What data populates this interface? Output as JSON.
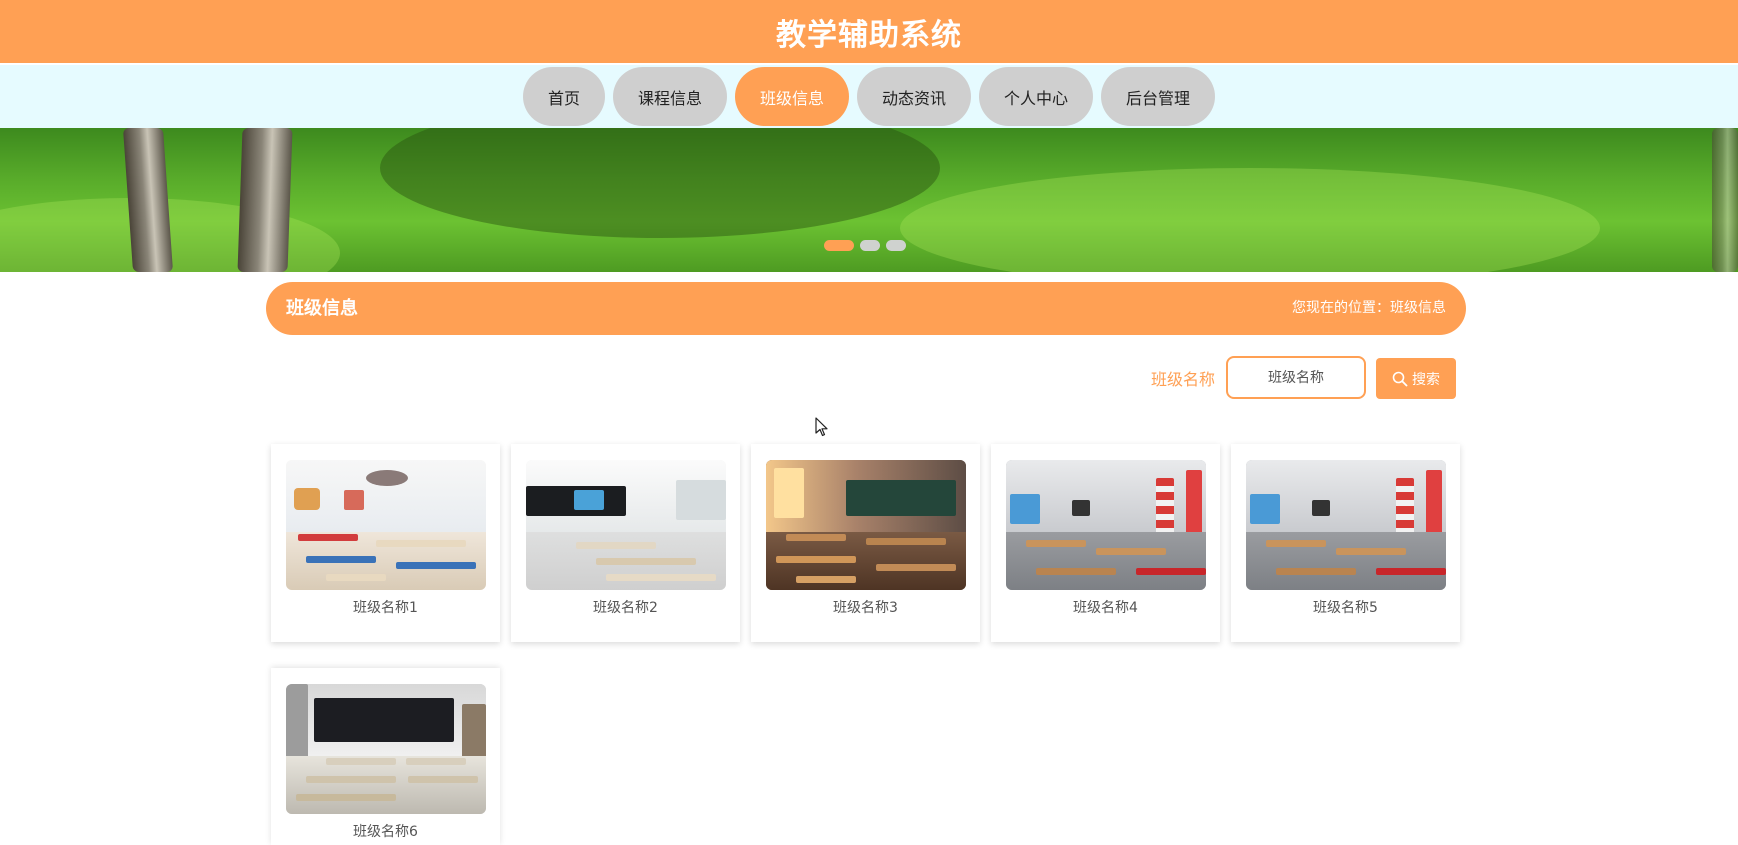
{
  "header": {
    "title": "教学辅助系统"
  },
  "nav": {
    "items": [
      {
        "label": "首页"
      },
      {
        "label": "课程信息"
      },
      {
        "label": "班级信息"
      },
      {
        "label": "动态资讯"
      },
      {
        "label": "个人中心"
      },
      {
        "label": "后台管理"
      }
    ],
    "active_index": 2
  },
  "banner": {
    "slide_count": 3,
    "active_slide": 1
  },
  "section": {
    "title": "班级信息",
    "breadcrumb": "您现在的位置：班级信息"
  },
  "search": {
    "label": "班级名称",
    "placeholder": "班级名称",
    "value": "",
    "button_label": "搜索"
  },
  "cards": [
    {
      "name": "班级名称1"
    },
    {
      "name": "班级名称2"
    },
    {
      "name": "班级名称3"
    },
    {
      "name": "班级名称4"
    },
    {
      "name": "班级名称5"
    },
    {
      "name": "班级名称6"
    }
  ],
  "colors": {
    "accent": "#ffa054",
    "nav_bg": "#e6fbff",
    "nav_item": "#cfcfcf"
  }
}
